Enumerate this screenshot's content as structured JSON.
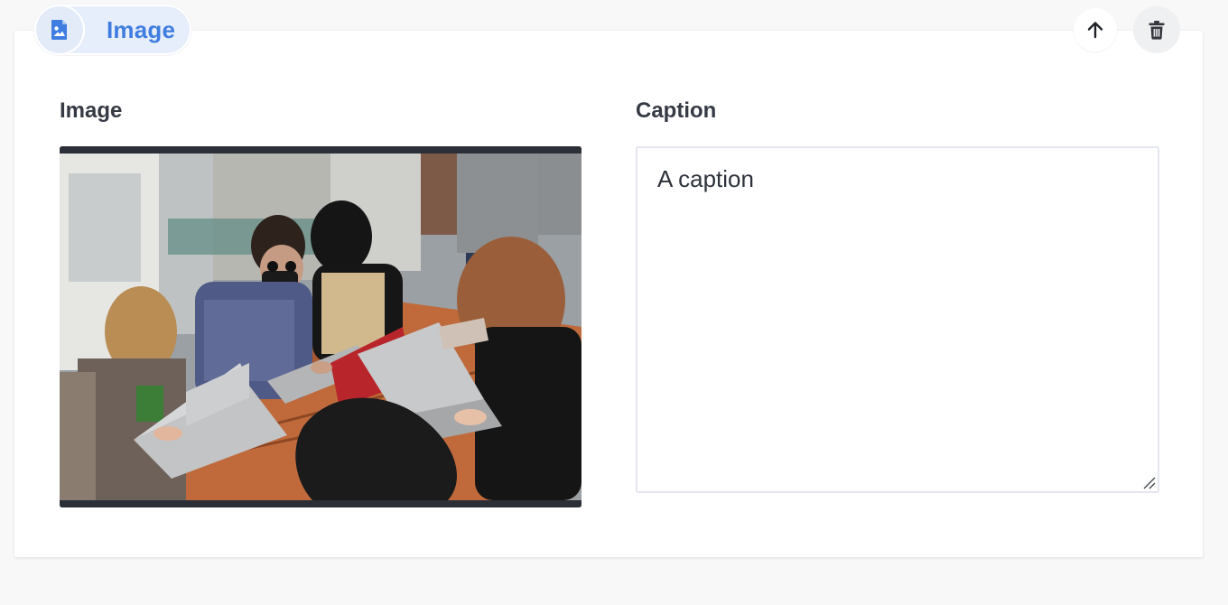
{
  "block": {
    "type_label": "Image",
    "type_icon": "image-file-icon",
    "accent_color": "#3f7de0",
    "actions": {
      "move_up_icon": "arrow-up-icon",
      "delete_icon": "trash-icon"
    }
  },
  "fields": {
    "image": {
      "label": "Image",
      "preview_alt": "Photo of people working on laptops at an outdoor wooden table"
    },
    "caption": {
      "label": "Caption",
      "value": "A caption"
    }
  }
}
